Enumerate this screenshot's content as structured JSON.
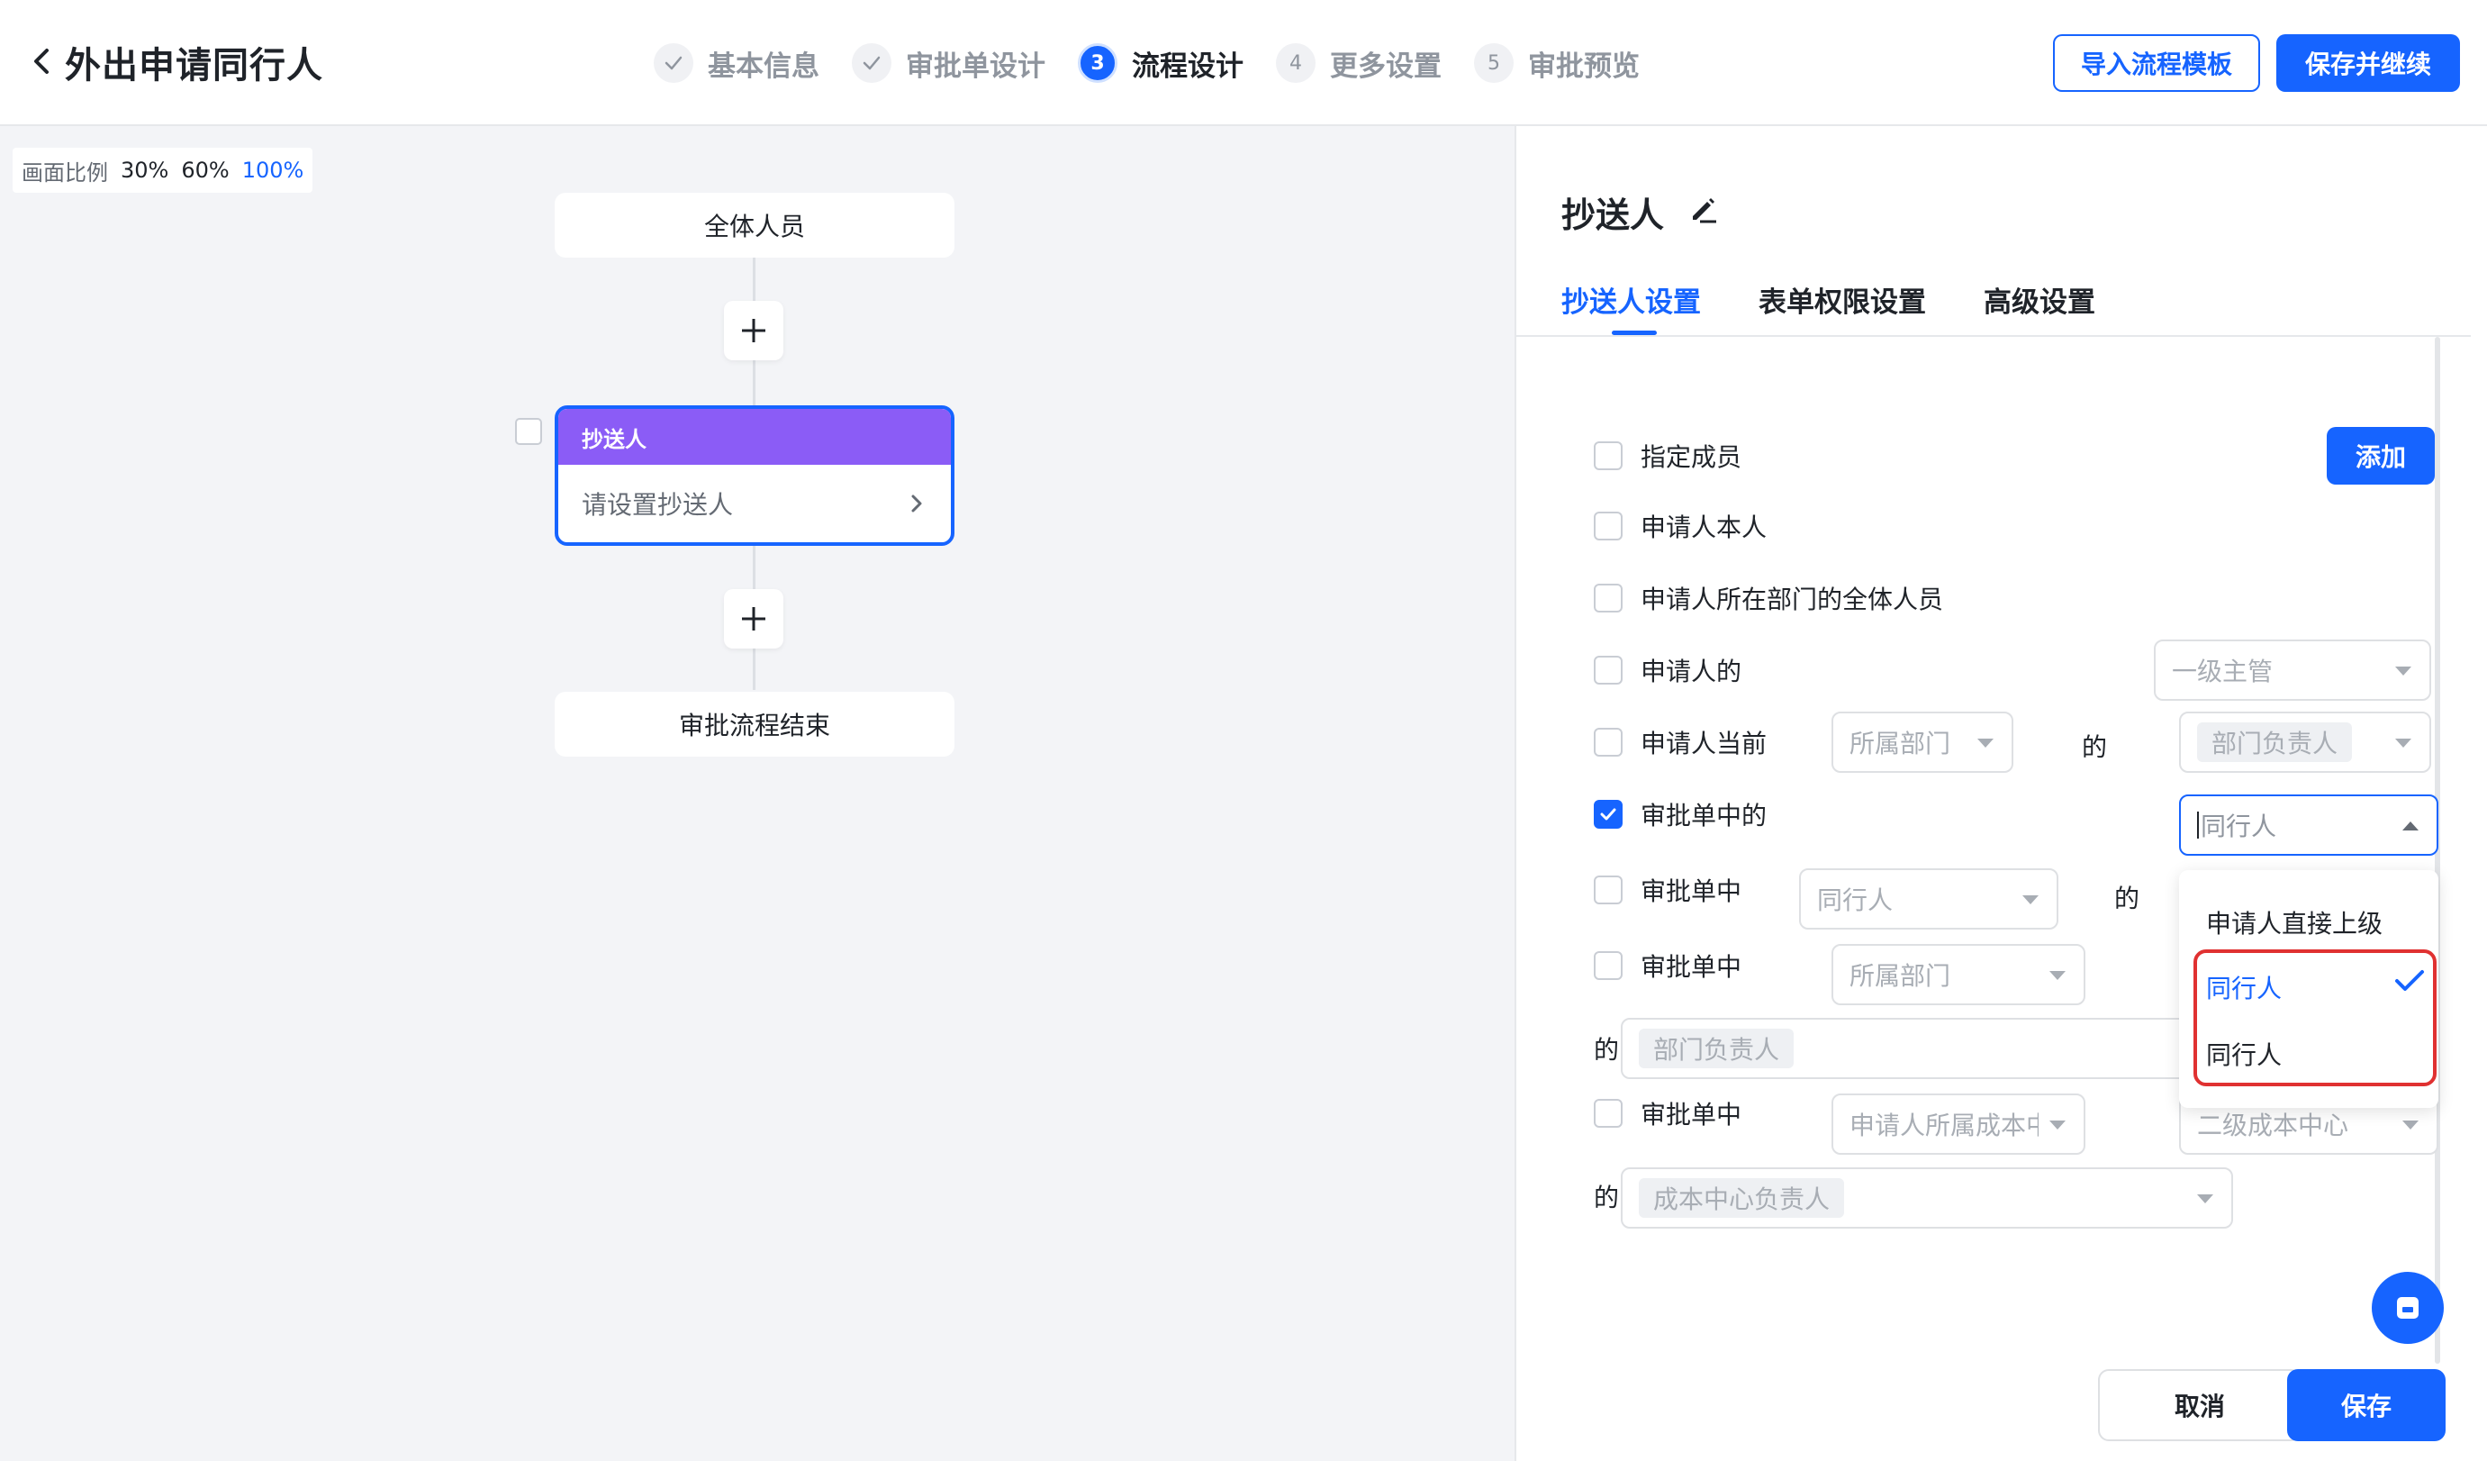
{
  "header": {
    "title": "外出申请同行人",
    "steps": [
      {
        "number": "",
        "label": "基本信息",
        "state": "done"
      },
      {
        "number": "",
        "label": "审批单设计",
        "state": "done"
      },
      {
        "number": "3",
        "label": "流程设计",
        "state": "active"
      },
      {
        "number": "4",
        "label": "更多设置",
        "state": "todo"
      },
      {
        "number": "5",
        "label": "审批预览",
        "state": "todo"
      }
    ],
    "import_template_label": "导入流程模板",
    "save_continue_label": "保存并继续"
  },
  "canvas": {
    "zoom_label": "画面比例",
    "zoom_options": [
      "30%",
      "60%",
      "100%"
    ],
    "zoom_selected": "100%",
    "start_node": "全体人员",
    "cc_node": {
      "title": "抄送人",
      "placeholder": "请设置抄送人"
    },
    "end_node": "审批流程结束"
  },
  "panel": {
    "title": "抄送人",
    "tabs": [
      "抄送人设置",
      "表单权限设置",
      "高级设置"
    ],
    "active_tab": "抄送人设置",
    "add_label": "添加",
    "of_label": "的",
    "options": [
      {
        "label": "指定成员",
        "checked": false
      },
      {
        "label": "申请人本人",
        "checked": false
      },
      {
        "label": "申请人所在部门的全体人员",
        "checked": false
      },
      {
        "label": "申请人的",
        "checked": false,
        "select": "一级主管"
      },
      {
        "label": "申请人当前",
        "checked": false,
        "select1": "所属部门",
        "select2": "部门负责人"
      },
      {
        "label": "审批单中的",
        "checked": true,
        "select": "同行人"
      },
      {
        "label": "审批单中",
        "checked": false,
        "select": "同行人"
      },
      {
        "label": "审批单中",
        "checked": false,
        "select1": "所属部门",
        "select2": "部门负责人"
      },
      {
        "label": "审批单中",
        "checked": false,
        "select1": "申请人所属成本中",
        "select2": "二级成本中心",
        "select3": "成本中心负责人"
      }
    ],
    "dropdown": {
      "items": [
        "申请人直接上级",
        "同行人",
        "同行人"
      ],
      "selected_index": 1
    },
    "cancel_label": "取消",
    "save_label": "保存"
  },
  "colors": {
    "primary": "#1664ff",
    "node_header": "#8b5cf6",
    "highlight": "#e03131"
  }
}
